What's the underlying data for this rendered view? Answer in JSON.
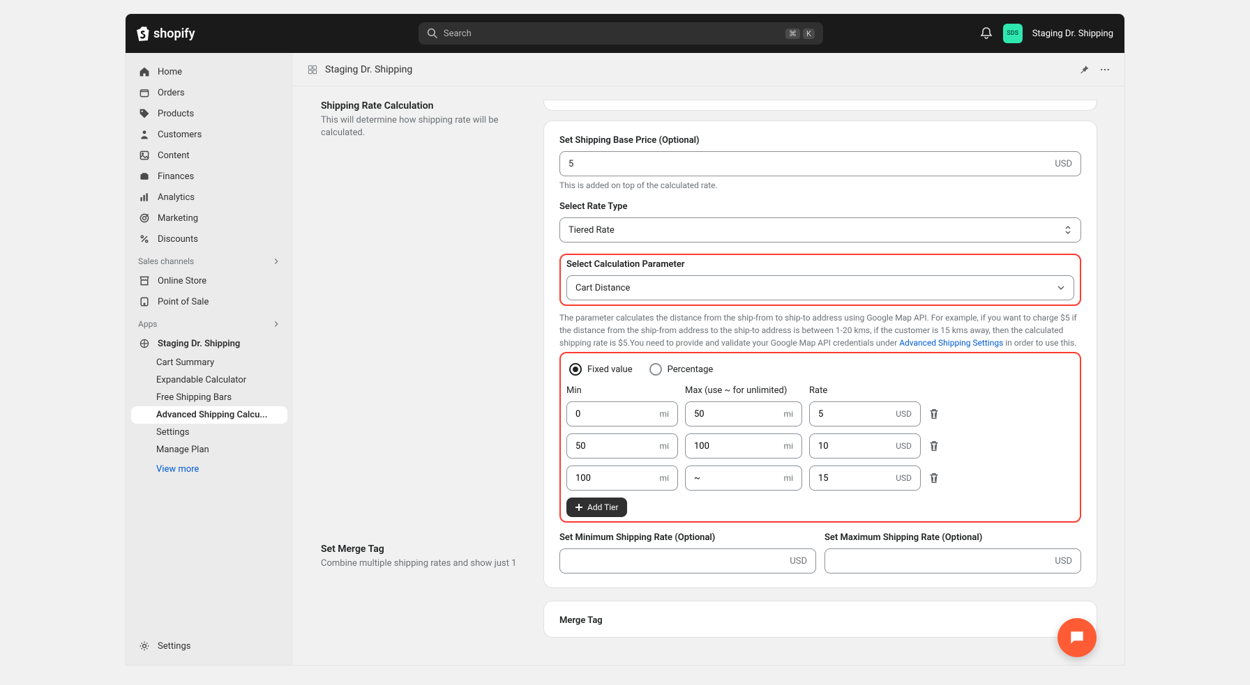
{
  "brand": "shopify",
  "search_placeholder": "Search",
  "kbd1": "⌘",
  "kbd2": "K",
  "account_name": "Staging Dr. Shipping",
  "avatar_text": "SDS",
  "nav": {
    "home": "Home",
    "orders": "Orders",
    "products": "Products",
    "customers": "Customers",
    "content": "Content",
    "finances": "Finances",
    "analytics": "Analytics",
    "marketing": "Marketing",
    "discounts": "Discounts",
    "sales_channels": "Sales channels",
    "online_store": "Online Store",
    "point_of_sale": "Point of Sale",
    "apps": "Apps",
    "app_name": "Staging Dr. Shipping",
    "sub_cart_summary": "Cart Summary",
    "sub_expandable": "Expandable Calculator",
    "sub_free_bars": "Free Shipping Bars",
    "sub_advanced": "Advanced Shipping Calcu...",
    "sub_settings": "Settings",
    "sub_manage_plan": "Manage Plan",
    "view_more": "View more",
    "settings": "Settings"
  },
  "page_title": "Staging Dr. Shipping",
  "section1": {
    "title": "Shipping Rate Calculation",
    "description": "This will determine how shipping rate will be calculated."
  },
  "section2": {
    "title": "Set Merge Tag",
    "description": "Combine multiple shipping rates and show just 1"
  },
  "form": {
    "base_price_label": "Set Shipping Base Price (Optional)",
    "base_price_value": "5",
    "currency": "USD",
    "base_price_help": "This is added on top of the calculated rate.",
    "rate_type_label": "Select Rate Type",
    "rate_type_value": "Tiered Rate",
    "calc_param_label": "Select Calculation Parameter",
    "calc_param_value": "Cart Distance",
    "calc_help_pre": "The parameter calculates the distance from the ship-from to ship-to address using Google Map API. For example, if you want to charge $5 if the distance from the ship-from address to the ship-to address is between 1-20 kms, if the customer is 15 kms away, then the calculated shipping rate is $5.You need to provide and validate your Google Map API credentials under ",
    "calc_help_link": "Advanced Shipping Settings",
    "calc_help_post": " in order to use this.",
    "radio_fixed": "Fixed value",
    "radio_percentage": "Percentage",
    "col_min": "Min",
    "col_max": "Max (use ~ for unlimited)",
    "col_rate": "Rate",
    "unit_mi": "mi",
    "unit_usd": "USD",
    "tiers": [
      {
        "min": "0",
        "max": "50",
        "rate": "5"
      },
      {
        "min": "50",
        "max": "100",
        "rate": "10"
      },
      {
        "min": "100",
        "max": "~",
        "rate": "15"
      }
    ],
    "add_tier": "Add Tier",
    "min_rate_label": "Set Minimum Shipping Rate (Optional)",
    "max_rate_label": "Set Maximum Shipping Rate (Optional)",
    "merge_tag_label": "Merge Tag"
  }
}
